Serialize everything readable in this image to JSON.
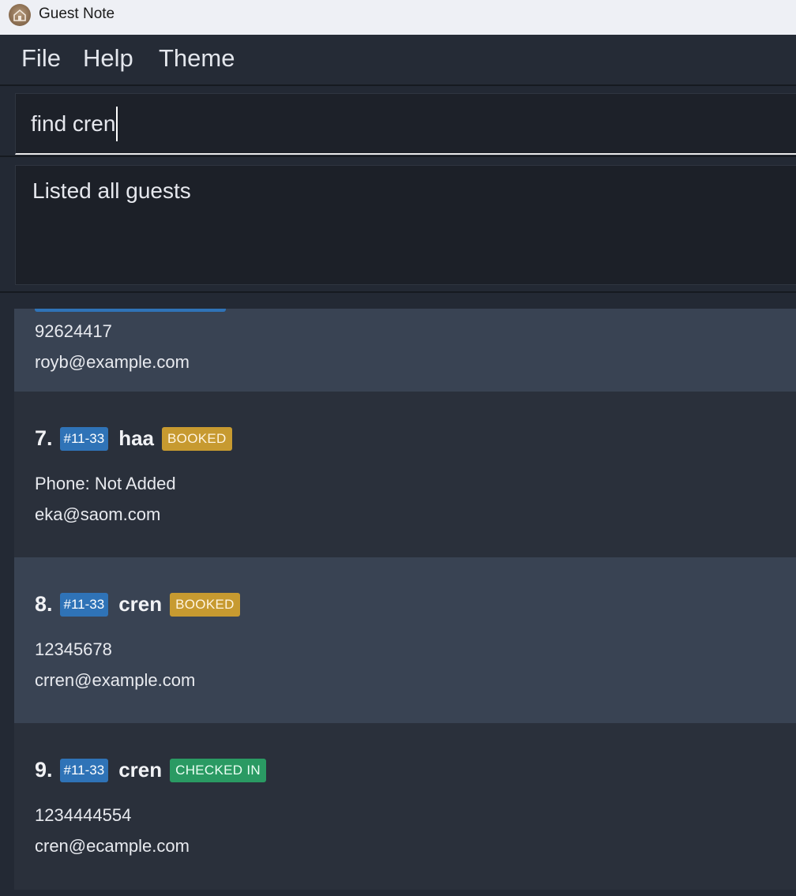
{
  "window": {
    "title": "Guest Note",
    "logo_icon": "hotel-logo-icon"
  },
  "menu": {
    "items": [
      "File",
      "Help",
      "Theme"
    ]
  },
  "command": {
    "value": "find cren"
  },
  "result": {
    "message": "Listed all guests"
  },
  "guests": [
    {
      "phone": "92624417",
      "email": "royb@example.com"
    },
    {
      "index": "7.",
      "room": "#11-33",
      "name": "haa",
      "status": "BOOKED",
      "phone": "Phone: Not Added",
      "email": "eka@saom.com"
    },
    {
      "index": "8.",
      "room": "#11-33",
      "name": "cren",
      "status": "BOOKED",
      "phone": "12345678",
      "email": "crren@example.com"
    },
    {
      "index": "9.",
      "room": "#11-33",
      "name": "cren",
      "status": "CHECKED IN",
      "phone": "1234444554",
      "email": "cren@ecample.com"
    }
  ],
  "colors": {
    "room_tag": "#2f73b7",
    "status_booked": "#c79a30",
    "status_checked_in": "#2a9a63",
    "card_light": "#394353",
    "card_dark": "#2a303b"
  }
}
